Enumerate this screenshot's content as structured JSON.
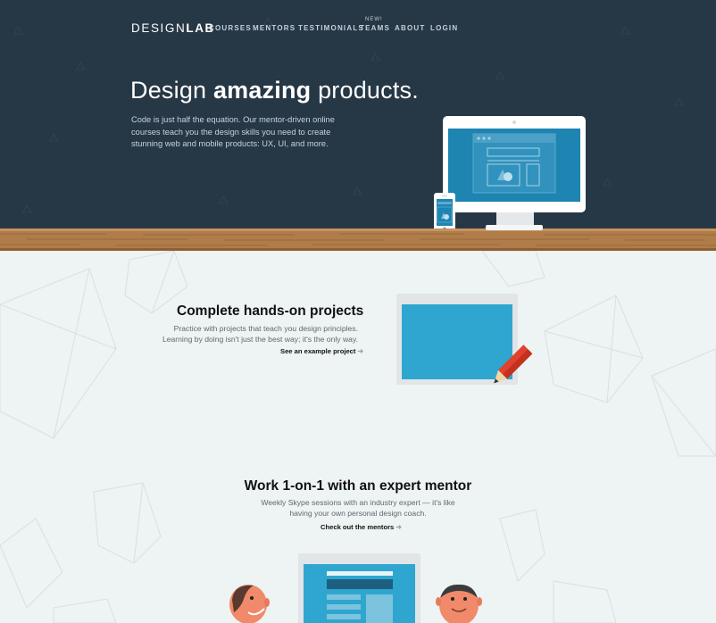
{
  "header": {
    "logo_light": "DESIGN",
    "logo_bold": "LAB",
    "nav": [
      {
        "label": "COURSES"
      },
      {
        "label": "MENTORS"
      },
      {
        "label": "TESTIMONIALS"
      },
      {
        "label": "TEAMS",
        "badge": "NEW!"
      },
      {
        "label": "ABOUT"
      },
      {
        "label": "LOGIN"
      }
    ]
  },
  "hero": {
    "title_pre": "Design",
    "title_bold": "amazing",
    "title_post": "products.",
    "subtitle": "Code is just half the equation. Our mentor-driven online courses teach you the design skills you need to create stunning web and mobile products: UX, UI, and more."
  },
  "projects": {
    "title": "Complete hands-on projects",
    "text_line1": "Practice with projects that teach you design principles.",
    "text_line2": "Learning by doing isn't just the best way; it's the only way.",
    "link": "See an example project"
  },
  "mentor": {
    "title": "Work 1-on-1 with an expert mentor",
    "text_line1": "Weekly Skype sessions with an industry expert — it's like",
    "text_line2": "having your own personal design coach.",
    "link": "Check out the mentors"
  },
  "colors": {
    "hero_bg": "#263746",
    "accent_blue": "#2fa6cf",
    "wood": "#b07c49",
    "section_bg": "#eef3f3",
    "pencil_red": "#e1412f"
  },
  "icons": {
    "link_arrow": "arrow-right-icon"
  }
}
